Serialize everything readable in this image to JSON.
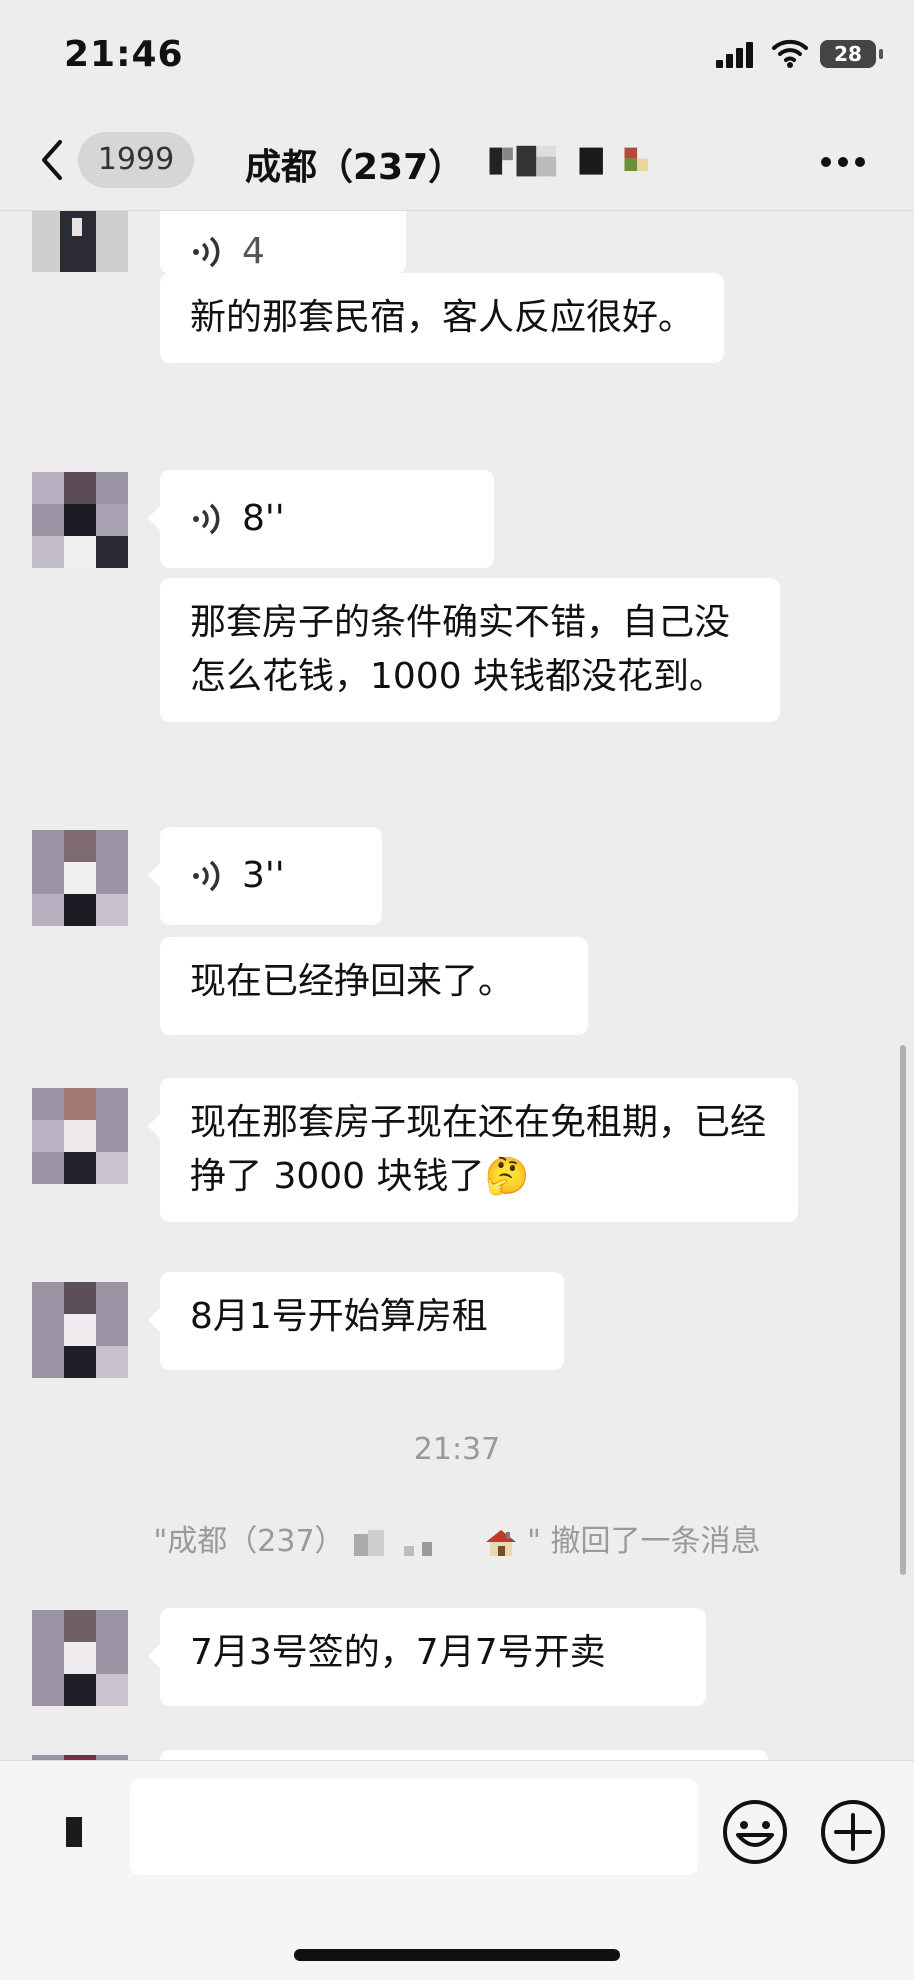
{
  "status_bar": {
    "time": "21:46",
    "battery": "28"
  },
  "nav": {
    "unread_count": "1999",
    "title": "成都（237）"
  },
  "messages": {
    "m0_voice": "4",
    "m1_text": "新的那套民宿，客人反应很好。",
    "m2_voice": "8''",
    "m3_text": "那套房子的条件确实不错，自己没怎么花钱，1000 块钱都没花到。",
    "m4_voice": "3''",
    "m5_text": "现在已经挣回来了。",
    "m6_text": "现在那套房子现在还在免租期，已经挣了 3000 块钱了🤔",
    "m7_text": "8月1号开始算房租",
    "timestamp": "21:37",
    "system_notice": "\"成都（237）",
    "system_notice_end": "\" 撤回了一条消息",
    "m8_text": "7月3号签的，7月7号开卖"
  },
  "icons": {
    "back": "chevron-left-icon",
    "more": "more-dots-icon",
    "voice": "sound-wave-icon",
    "emoji": "smiley-icon",
    "plus": "plus-circle-icon"
  },
  "colors": {
    "background": "#ededed",
    "bubble": "#ffffff",
    "meta_text": "#9a9a9a"
  }
}
